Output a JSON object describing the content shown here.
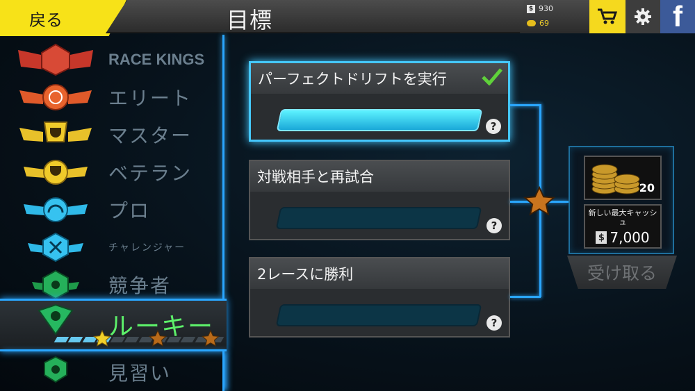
{
  "topbar": {
    "back_label": "戻る",
    "title": "目標",
    "cash": "930",
    "gold": "69"
  },
  "ranks": [
    {
      "label": "RACE KINGS",
      "icon": "race-kings-emblem-icon"
    },
    {
      "label": "エリート",
      "icon": "elite-emblem-icon"
    },
    {
      "label": "マスター",
      "icon": "master-emblem-icon"
    },
    {
      "label": "ベテラン",
      "icon": "veteran-emblem-icon"
    },
    {
      "label": "プロ",
      "icon": "pro-emblem-icon"
    },
    {
      "label": "チャレンジャー",
      "icon": "challenger-emblem-icon"
    },
    {
      "label": "競争者",
      "icon": "competitor-emblem-icon"
    }
  ],
  "current_rank": {
    "label": "ルーキー",
    "stars_earned": 1,
    "stars_total": 3
  },
  "next_rank": {
    "label": "見習い"
  },
  "goals": [
    {
      "label": "パーフェクトドリフトを実行",
      "completed": true,
      "progress": 1.0
    },
    {
      "label": "対戦相手と再試合",
      "completed": false,
      "progress": 0.0
    },
    {
      "label": "2レースに勝利",
      "completed": false,
      "progress": 0.0
    }
  ],
  "reward": {
    "gold_amount": "20",
    "cash_title": "新しい最大キャッシュ",
    "cash_amount": "7,000",
    "claim_label": "受け取る"
  },
  "help_label": "?",
  "colors": {
    "accent_blue": "#2aa6ff",
    "rookie_green": "#5df06a",
    "yellow": "#f7e218"
  }
}
